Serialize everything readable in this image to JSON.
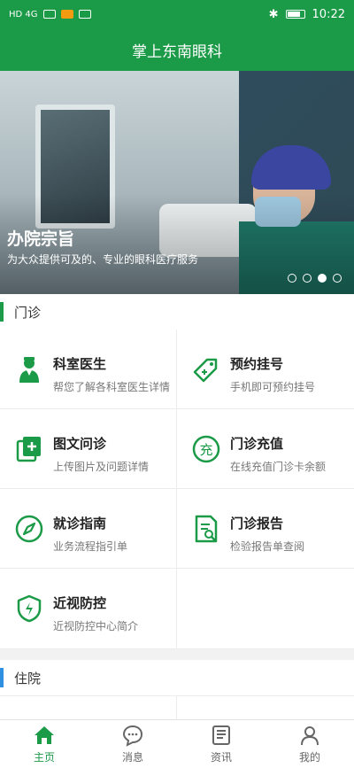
{
  "statusbar": {
    "left_text": "HD 4G",
    "time": "10:22"
  },
  "header": {
    "title": "掌上东南眼科"
  },
  "banner": {
    "title": "办院宗旨",
    "subtitle": "为大众提供可及的、专业的眼科医疗服务",
    "slides": 4,
    "active_slide": 3
  },
  "sections": {
    "outpatient": "门诊",
    "inpatient": "住院"
  },
  "services": [
    {
      "title": "科室医生",
      "desc": "帮您了解各科室医生详情",
      "icon": "doctor-icon"
    },
    {
      "title": "预约挂号",
      "desc": "手机即可预约挂号",
      "icon": "tag-icon"
    },
    {
      "title": "图文问诊",
      "desc": "上传图片及问题详情",
      "icon": "add-image-icon"
    },
    {
      "title": "门诊充值",
      "desc": "在线充值门诊卡余额",
      "icon": "recharge-icon"
    },
    {
      "title": "就诊指南",
      "desc": "业务流程指引单",
      "icon": "compass-icon"
    },
    {
      "title": "门诊报告",
      "desc": "检验报告单查阅",
      "icon": "report-icon"
    },
    {
      "title": "近视防控",
      "desc": "近视防控中心简介",
      "icon": "shield-icon"
    }
  ],
  "tabs": [
    {
      "label": "主页",
      "icon": "home-icon",
      "active": true
    },
    {
      "label": "消息",
      "icon": "chat-icon",
      "active": false
    },
    {
      "label": "资讯",
      "icon": "news-icon",
      "active": false
    },
    {
      "label": "我的",
      "icon": "user-icon",
      "active": false
    }
  ],
  "colors": {
    "primary": "#1b9a47",
    "accent_blue": "#2f8fe0"
  }
}
